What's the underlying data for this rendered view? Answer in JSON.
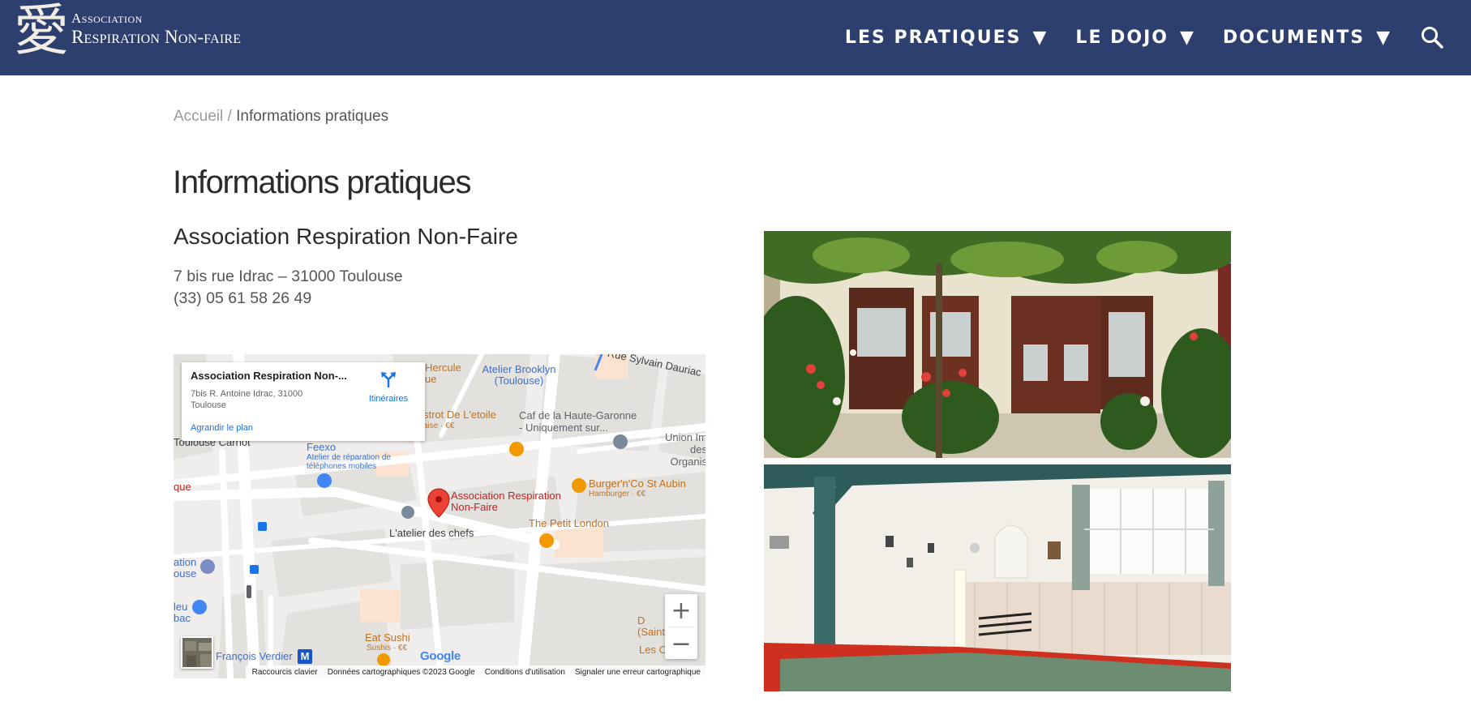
{
  "header": {
    "logo_glyph": "愛",
    "logo_small": "Association",
    "logo_big": "Respiration Non-faire",
    "nav": [
      {
        "label": "LES PRATIQUES",
        "caret": "▼"
      },
      {
        "label": "LE DOJO",
        "caret": "▼"
      },
      {
        "label": "DOCUMENTS",
        "caret": "▼"
      }
    ],
    "search_icon": "search-icon"
  },
  "breadcrumb": {
    "home": "Accueil",
    "separator": " / ",
    "current": "Informations pratiques"
  },
  "page": {
    "title": "Informations pratiques",
    "org_name": "Association Respiration Non-Faire",
    "address": "7 bis rue Idrac – 31000 Toulouse",
    "phone": "(33) 05 61 58 26 49"
  },
  "map": {
    "card_title": "Association Respiration Non-...",
    "card_address": "7bis R. Antoine Idrac, 31000 Toulouse",
    "directions": "Itinéraires",
    "enlarge": "Agrandir le plan",
    "marker_label": "Association Respiration Non-Faire",
    "labels": {
      "rue_sylvain": "Rue Sylvain Dauriac",
      "hercule": "Hercule",
      "hercule2": "ue",
      "atelier_brooklyn": "Atelier Brooklyn (Toulouse)",
      "bistrot": "strot De L'etoile",
      "bistrot_sub": "aise · €€",
      "caf": "Caf de la Haute-Garonne - Uniquement sur...",
      "union": "Union Im des Organis",
      "toulouse_carnot": "Toulouse Carnot",
      "feexo": "Feexo",
      "feexo_sub": "Atelier de réparation de téléphones mobiles",
      "que": "que",
      "burger": "Burger'n'Co St Aubin",
      "burger_sub": "Hamburger · €€",
      "petit_london": "The Petit London",
      "atelier_chefs": "L'atelier des chefs",
      "station": "ation ouse",
      "bleu": "leu bac",
      "eat_sushi": "Eat Sushi",
      "eat_sushi_sub": "Sushis · €€",
      "saint": "D (Saint",
      "les_c": "Les C",
      "francois": "François Verdier",
      "metro": "M"
    },
    "google": "Google",
    "footer": [
      "Raccourcis clavier",
      "Données cartographiques ©2023 Google",
      "Conditions d'utilisation",
      "Signaler une erreur cartographique"
    ],
    "zoom_in": "+",
    "zoom_out": "−"
  },
  "photos": [
    {
      "alt": "Entrée du dojo fleurie"
    },
    {
      "alt": "Intérieur du dojo"
    }
  ],
  "colors": {
    "header_bg": "#2c3f6e",
    "accent_blue": "#1a73e8",
    "marker_red": "#ea4335"
  }
}
